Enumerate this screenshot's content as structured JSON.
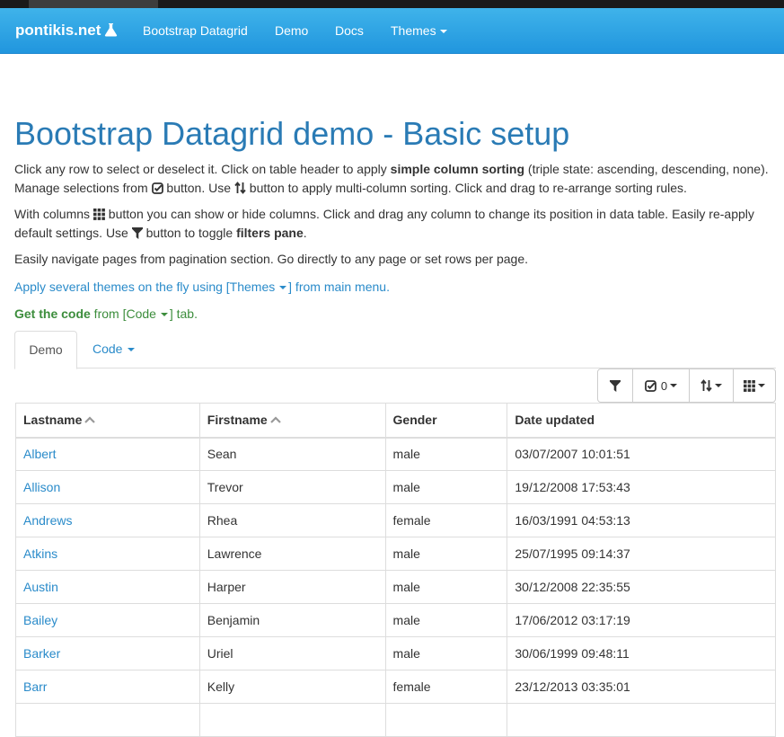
{
  "navbar": {
    "brand": "pontikis.net",
    "brand_icon": "flask-icon",
    "items": [
      {
        "label": "Bootstrap Datagrid"
      },
      {
        "label": "Demo"
      },
      {
        "label": "Docs"
      },
      {
        "label": "Themes"
      }
    ]
  },
  "page": {
    "title": "Bootstrap Datagrid demo - Basic setup",
    "p1": {
      "t1": "Click any row to select or deselect it. Click on table header to apply ",
      "b1": "simple column sorting",
      "t2": " (triple state: ascending, descending, none). Manage selections from ",
      "t3": " button. Use ",
      "t4": " button to apply multi-column sorting. Click and drag to re-arrange sorting rules."
    },
    "p2": {
      "t1": "With columns ",
      "t2": " button you can show or hide columns. Click and drag any column to change its position in data table. Easily re-apply default settings. Use ",
      "t3": " button to toggle ",
      "b1": "filters pane",
      "t4": "."
    },
    "p3": "Easily navigate pages from pagination section. Go directly to any page or set rows per page.",
    "p4": {
      "t1": "Apply several themes on the fly using [Themes ",
      "t2": "] from main menu."
    },
    "p5": {
      "b1": "Get the code",
      "t1": " from [Code ",
      "t2": "] tab."
    }
  },
  "tabs": [
    {
      "label": "Demo"
    },
    {
      "label": "Code"
    }
  ],
  "toolbar": {
    "filter_icon": "filter-icon",
    "selection_count": "0",
    "selection_icon": "check-square-icon",
    "sort_icon": "sort-icon",
    "columns_icon": "grid-icon"
  },
  "grid": {
    "columns": [
      "Lastname",
      "Firstname",
      "Gender",
      "Date updated"
    ],
    "rows": [
      [
        "Albert",
        "Sean",
        "male",
        "03/07/2007 10:01:51"
      ],
      [
        "Allison",
        "Trevor",
        "male",
        "19/12/2008 17:53:43"
      ],
      [
        "Andrews",
        "Rhea",
        "female",
        "16/03/1991 04:53:13"
      ],
      [
        "Atkins",
        "Lawrence",
        "male",
        "25/07/1995 09:14:37"
      ],
      [
        "Austin",
        "Harper",
        "male",
        "30/12/2008 22:35:55"
      ],
      [
        "Bailey",
        "Benjamin",
        "male",
        "17/06/2012 03:17:19"
      ],
      [
        "Barker",
        "Uriel",
        "male",
        "30/06/1999 09:48:11"
      ],
      [
        "Barr",
        "Kelly",
        "female",
        "23/12/2013 03:35:01"
      ],
      [
        "",
        "",
        "",
        ""
      ]
    ]
  },
  "colors": {
    "navbar": "#2ba3e6",
    "link": "#2a8bca",
    "title": "#2a7bb5",
    "green": "#3c8d3c"
  }
}
